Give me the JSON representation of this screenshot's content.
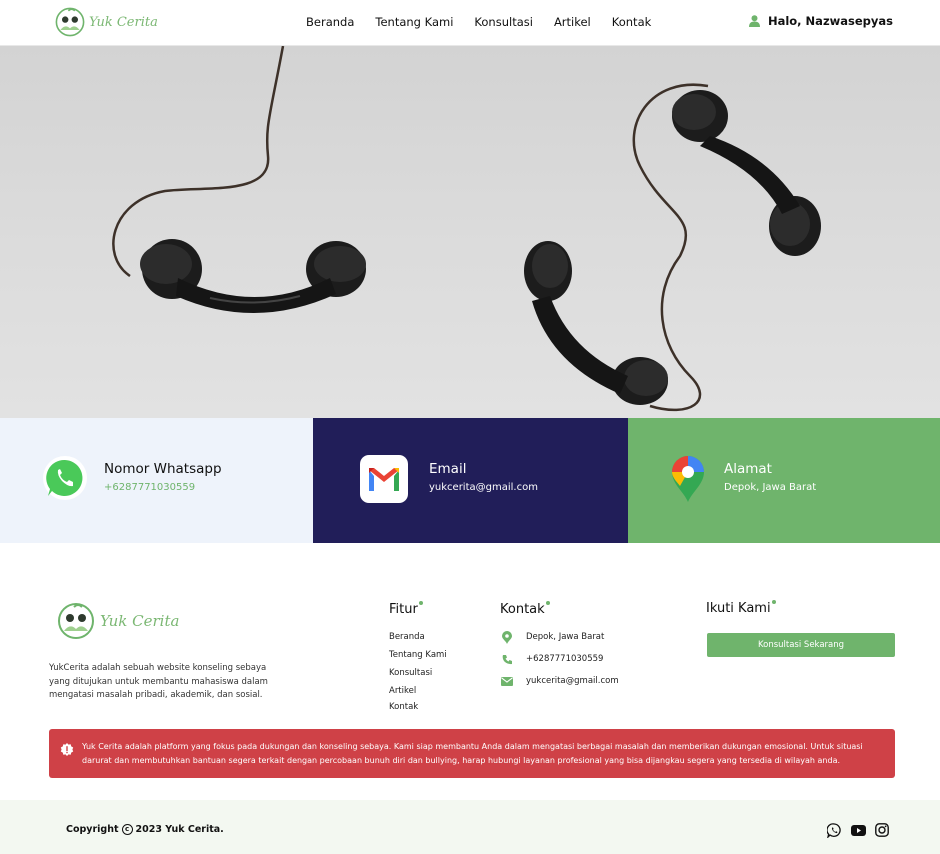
{
  "brand": {
    "name": "Yuk Cerita",
    "accent": "#6fb46c",
    "navy": "#211e59",
    "alert": "#cf4147"
  },
  "nav": {
    "items": [
      {
        "label": "Beranda"
      },
      {
        "label": "Tentang Kami"
      },
      {
        "label": "Konsultasi"
      },
      {
        "label": "Artikel"
      },
      {
        "label": "Kontak"
      }
    ],
    "user_greeting": "Halo, Nazwasepyas",
    "user_icon": "user-icon"
  },
  "contact_cards": [
    {
      "title": "Nomor Whatsapp",
      "value": "+6287771030559",
      "icon": "whatsapp-icon"
    },
    {
      "title": "Email",
      "value": "yukcerita@gmail.com",
      "icon": "gmail-icon"
    },
    {
      "title": "Alamat",
      "value": "Depok, Jawa Barat",
      "icon": "maps-pin-icon"
    }
  ],
  "footer": {
    "description": "YukCerita adalah sebuah website konseling sebaya yang ditujukan untuk membantu mahasiswa dalam mengatasi masalah pribadi, akademik, dan sosial.",
    "fitur": {
      "title": "Fitur",
      "items": [
        "Beranda",
        "Tentang Kami",
        "Konsultasi",
        "Artikel",
        "Kontak"
      ]
    },
    "kontak": {
      "title": "Kontak",
      "items": [
        {
          "icon": "location-pin-icon",
          "text": "Depok, Jawa Barat"
        },
        {
          "icon": "phone-icon",
          "text": "+6287771030559"
        },
        {
          "icon": "mail-icon",
          "text": "yukcerita@gmail.com"
        }
      ]
    },
    "ikuti": {
      "title": "Ikuti Kami",
      "button": "Konsultasi Sekarang"
    },
    "alert": "Yuk Cerita adalah platform yang fokus pada dukungan dan konseling sebaya. Kami siap membantu Anda dalam mengatasi berbagai masalah dan memberikan dukungan emosional. Untuk situasi darurat dan membutuhkan bantuan segera terkait dengan percobaan bunuh diri dan bullying, harap hubungi layanan profesional yang bisa dijangkau segera yang tersedia di wilayah anda.",
    "copyright_prefix": "Copyright",
    "copyright_symbol": "c",
    "copyright_suffix": "2023 Yuk Cerita.",
    "socials": [
      "whatsapp-icon",
      "youtube-icon",
      "instagram-icon"
    ]
  }
}
